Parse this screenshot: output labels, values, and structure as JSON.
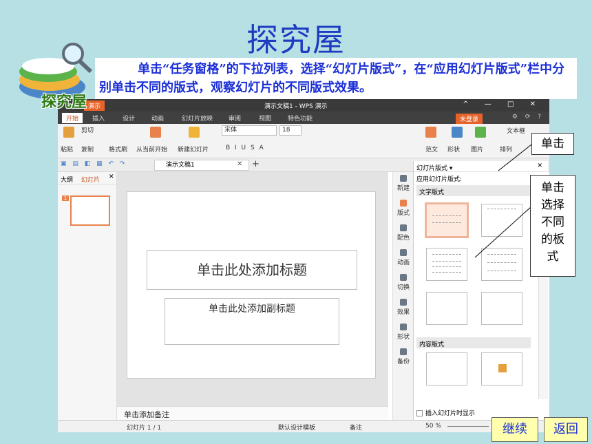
{
  "slide": {
    "title": "探究屋",
    "instruction": "单击“任务窗格”的下拉列表，选择“幻灯片版式”，在“应用幻灯片版式”栏中分别单击不同的版式，观察幻灯片的不同版式效果。",
    "logo_text": "探究屋",
    "callout_click": "单击",
    "callout_select": [
      "单击",
      "选择",
      "不同",
      "的板",
      "式"
    ],
    "continue_label": "继续",
    "back_label": "返回"
  },
  "app": {
    "menu_button": "演示",
    "window_title": "演示文稿1 - WPS 演示",
    "window_controls": "^ — □ ✕",
    "tabs": [
      "开始",
      "插入",
      "设计",
      "动画",
      "幻灯片放映",
      "审阅",
      "视图",
      "特色功能"
    ],
    "login": "未登录",
    "ribbon": {
      "paste": "粘贴",
      "cut": "剪切",
      "copy": "复制",
      "format_painter": "格式刷",
      "from_start": "从当前开始",
      "new_slide": "新建幻灯片",
      "font": "宋体",
      "size": "18",
      "font_styles": "B  I  U  S  A",
      "layout_btn": "范文",
      "shape": "形状",
      "picture": "图片",
      "arrange": "排列",
      "textbox": "文本框"
    },
    "doc_tab": "演示文稿1",
    "left_tabs": [
      "大纲",
      "幻灯片"
    ],
    "thumb_num": "1",
    "placeholder_title": "单击此处添加标题",
    "placeholder_subtitle": "单击此处添加副标题",
    "notes": "单击添加备注",
    "side_tools": [
      "新建",
      "版式",
      "配色",
      "动画",
      "切换",
      "效果",
      "形状",
      "备份"
    ],
    "task_pane": {
      "header": "幻灯片版式",
      "apply_label": "应用幻灯片版式:",
      "section_text": "文字版式",
      "section_content": "内容版式",
      "footer": "插入幻灯片时显示"
    },
    "status": {
      "slide_count": "幻灯片 1 / 1",
      "template": "默认设计模板",
      "notes_btn": "备注",
      "zoom": "50 %"
    }
  },
  "colors": {
    "title_blue": "#1f3bbf",
    "accent_orange": "#e8632a",
    "bg": "#b6e0e4"
  }
}
